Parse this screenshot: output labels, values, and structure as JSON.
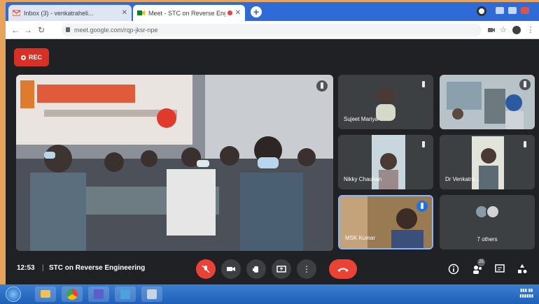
{
  "browser": {
    "tabs": [
      {
        "title": "Inbox (3) - venkatraheli...",
        "icon": "gmail-icon"
      },
      {
        "title": "Meet - STC on Reverse Engi",
        "icon": "meet-icon"
      }
    ],
    "url": "meet.google.com/rqp-jksr-npe"
  },
  "meet": {
    "rec_label": "REC",
    "time": "12:53",
    "separator": "|",
    "meeting_title": "STC on Reverse Engineering",
    "participants": [
      {
        "name": "Sujeet Mariya"
      },
      {
        "name": ""
      },
      {
        "name": "Nikky Chauhan"
      },
      {
        "name": "Dr Venkatra..."
      },
      {
        "name": "MSK Kumar"
      },
      {
        "name": "7 others"
      }
    ],
    "participant_count": "25"
  },
  "colors": {
    "accent_red": "#ea4335",
    "meet_bg": "#202124",
    "tile_bg": "#3c4043",
    "active_speaker_border": "#8ab4f8"
  }
}
